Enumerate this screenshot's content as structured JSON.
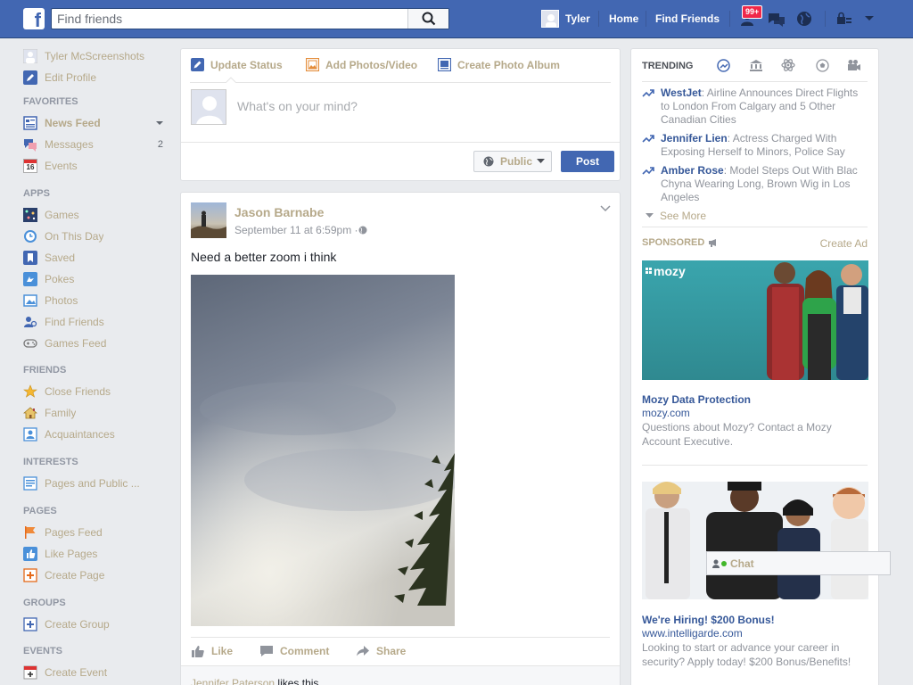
{
  "topbar": {
    "logo": "f",
    "search_placeholder": "Find friends",
    "user_name": "Tyler",
    "nav_home": "Home",
    "nav_find_friends": "Find Friends",
    "friend_requests_badge": "99+"
  },
  "leftnav": {
    "profile_name": "Tyler McScreenshots",
    "edit_profile": "Edit Profile",
    "favorites_header": "FAVORITES",
    "news_feed": "News Feed",
    "messages": "Messages",
    "messages_count": "2",
    "events": "Events",
    "events_icon_day": "16",
    "apps_header": "APPS",
    "games": "Games",
    "on_this_day": "On This Day",
    "saved": "Saved",
    "pokes": "Pokes",
    "photos": "Photos",
    "find_friends": "Find Friends",
    "games_feed": "Games Feed",
    "friends_header": "FRIENDS",
    "close_friends": "Close Friends",
    "family": "Family",
    "acquaintances": "Acquaintances",
    "interests_header": "INTERESTS",
    "pages_and_public": "Pages and Public ...",
    "pages_header": "PAGES",
    "pages_feed": "Pages Feed",
    "like_pages": "Like Pages",
    "create_page": "Create Page",
    "groups_header": "GROUPS",
    "create_group": "Create Group",
    "events_header": "EVENTS",
    "create_event": "Create Event"
  },
  "composer": {
    "tab_update_status": "Update Status",
    "tab_add_photos": "Add Photos/Video",
    "tab_create_album": "Create Photo Album",
    "placeholder": "What's on your mind?",
    "privacy": "Public",
    "post_button": "Post"
  },
  "post": {
    "author": "Jason Barnabe",
    "time": "September 11 at 6:59pm · ",
    "text": "Need a better zoom i think",
    "action_like": "Like",
    "action_comment": "Comment",
    "action_share": "Share",
    "liker": "Jennifer Paterson",
    "likes_suffix": " likes this."
  },
  "trending": {
    "header": "TRENDING",
    "items": [
      {
        "name": "WestJet",
        "text": ": Airline Announces Direct Flights to London From Calgary and 5 Other Canadian Cities"
      },
      {
        "name": "Jennifer Lien",
        "text": ": Actress Charged With Exposing Herself to Minors, Police Say"
      },
      {
        "name": "Amber Rose",
        "text": ": Model Steps Out With Blac Chyna Wearing Long, Brown Wig in Los Angeles"
      }
    ],
    "see_more": "See More"
  },
  "sponsored": {
    "header": "SPONSORED",
    "create_ad": "Create Ad",
    "ads": [
      {
        "logo": "mozy",
        "title": "Mozy Data Protection",
        "url": "mozy.com",
        "desc": "Questions about Mozy? Contact a Mozy Account Executive."
      },
      {
        "title": "We're Hiring! $200 Bonus!",
        "url": "www.intelligarde.com",
        "desc": "Looking to start or advance your career in security? Apply today! $200 Bonus/Benefits!"
      }
    ]
  },
  "chat": {
    "label": "Chat"
  },
  "colors": {
    "brand_blue": "#4267b2",
    "link_blue": "#365899",
    "visited_tan": "#b6a98a",
    "badge_red": "#f02849"
  }
}
